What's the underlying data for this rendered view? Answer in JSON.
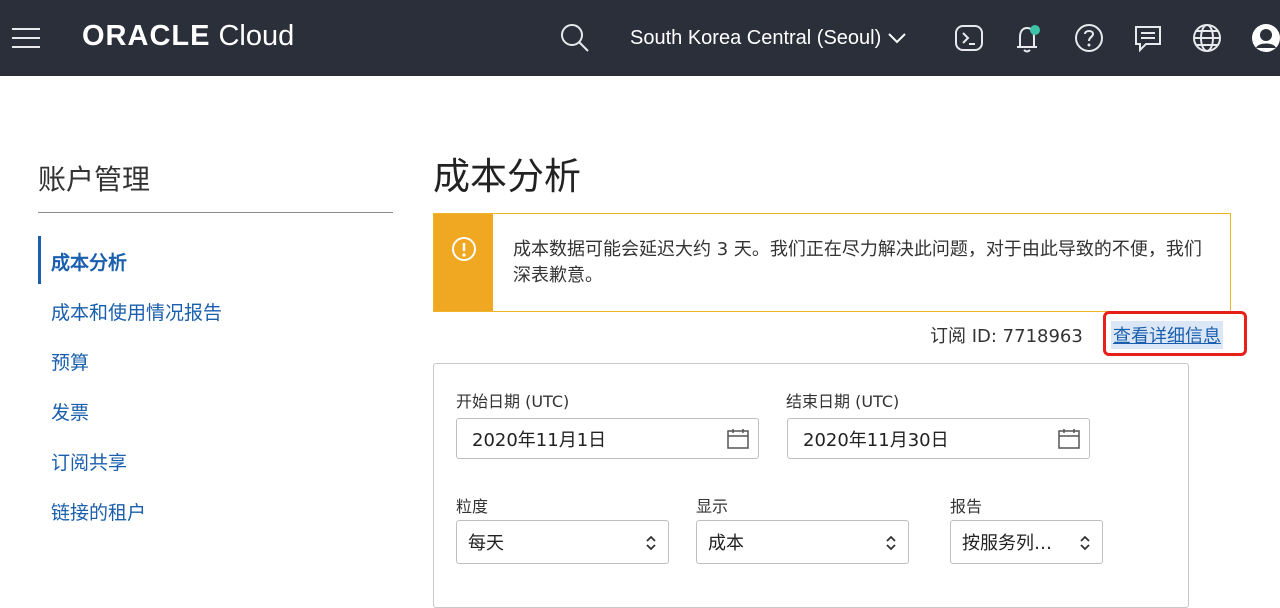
{
  "header": {
    "brand_oracle": "ORACLE",
    "brand_cloud": "Cloud",
    "region": "South Korea Central (Seoul)",
    "icons": [
      "menu-icon",
      "search-icon",
      "chevron-down-icon",
      "cloud-shell-icon",
      "bell-icon",
      "help-icon",
      "chat-icon",
      "globe-icon",
      "user-icon"
    ],
    "colors": {
      "bar": "#2a2f39",
      "bell_dot": "#3ec3a8"
    }
  },
  "sidebar": {
    "title": "账户管理",
    "items": [
      {
        "label": "成本分析",
        "active": true
      },
      {
        "label": "成本和使用情况报告",
        "active": false
      },
      {
        "label": "预算",
        "active": false
      },
      {
        "label": "发票",
        "active": false
      },
      {
        "label": "订阅共享",
        "active": false
      },
      {
        "label": "链接的租户",
        "active": false
      }
    ]
  },
  "main": {
    "title": "成本分析",
    "notice": {
      "icon": "warning-icon",
      "text": "成本数据可能会延迟大约 3 天。我们正在尽力解决此问题，对于由此导致的不便，我们深表歉意。",
      "color": "#f0a823"
    },
    "subscription": {
      "label": "订阅 ID: 7718963",
      "details_link": "查看详细信息",
      "highlight_color": "#e8201a"
    },
    "filters": {
      "start_label": "开始日期 (UTC)",
      "start_value": "2020年11月1日",
      "end_label": "结束日期 (UTC)",
      "end_value": "2020年11月30日",
      "granularity_label": "粒度",
      "granularity_value": "每天",
      "show_label": "显示",
      "show_value": "成本",
      "report_label": "报告",
      "report_value": "按服务列…"
    }
  }
}
